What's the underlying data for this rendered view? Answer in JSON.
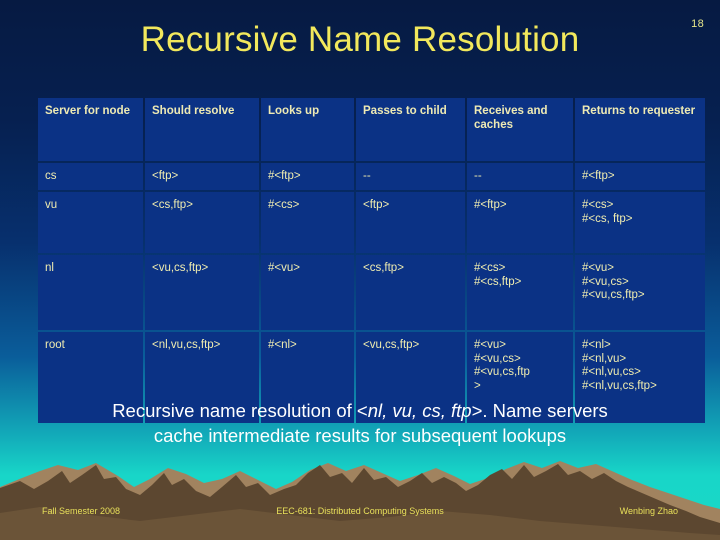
{
  "slide": {
    "number": "18",
    "title": "Recursive Name Resolution",
    "caption": {
      "line1_pre": "Recursive name resolution of <",
      "line1_italic": "nl, vu, cs, ftp",
      "line1_post": ">. Name servers",
      "line2": "cache intermediate results for subsequent lookups"
    }
  },
  "table": {
    "headers": [
      "Server for node",
      "Should resolve",
      "Looks up",
      "Passes to child",
      "Receives and caches",
      "Returns to requester"
    ],
    "rows": [
      {
        "server": "cs",
        "should_resolve": "<ftp>",
        "looks_up": "#<ftp>",
        "passes_to_child": "--",
        "receives_and_caches": "--",
        "returns_to_requester": "#<ftp>"
      },
      {
        "server": "vu",
        "should_resolve": "<cs,ftp>",
        "looks_up": "#<cs>",
        "passes_to_child": "<ftp>",
        "receives_and_caches": "#<ftp>",
        "returns_to_requester": "#<cs>\n#<cs, ftp>"
      },
      {
        "server": "nl",
        "should_resolve": "<vu,cs,ftp>",
        "looks_up": "#<vu>",
        "passes_to_child": "<cs,ftp>",
        "receives_and_caches": "#<cs>\n#<cs,ftp>",
        "returns_to_requester": "#<vu>\n#<vu,cs>\n#<vu,cs,ftp>"
      },
      {
        "server": "root",
        "should_resolve": "<nl,vu,cs,ftp>",
        "looks_up": "#<nl>",
        "passes_to_child": "<vu,cs,ftp>",
        "receives_and_caches": "#<vu>\n#<vu,cs>\n#<vu,cs,ftp\n>",
        "returns_to_requester": "#<nl>\n#<nl,vu>\n#<nl,vu,cs>\n#<nl,vu,cs,ftp>"
      }
    ]
  },
  "footer": {
    "left": "Fall Semester 2008",
    "center": "EEC-681: Distributed Computing Systems",
    "right": "Wenbing Zhao"
  },
  "colors": {
    "title": "#f2e85c",
    "cell_bg": "#0b3285",
    "cell_text": "#f0edb0",
    "caption": "#ffffff",
    "footer_text": "#e8e05a",
    "mountain_light": "#a6876a",
    "mountain_dark": "#584430"
  }
}
